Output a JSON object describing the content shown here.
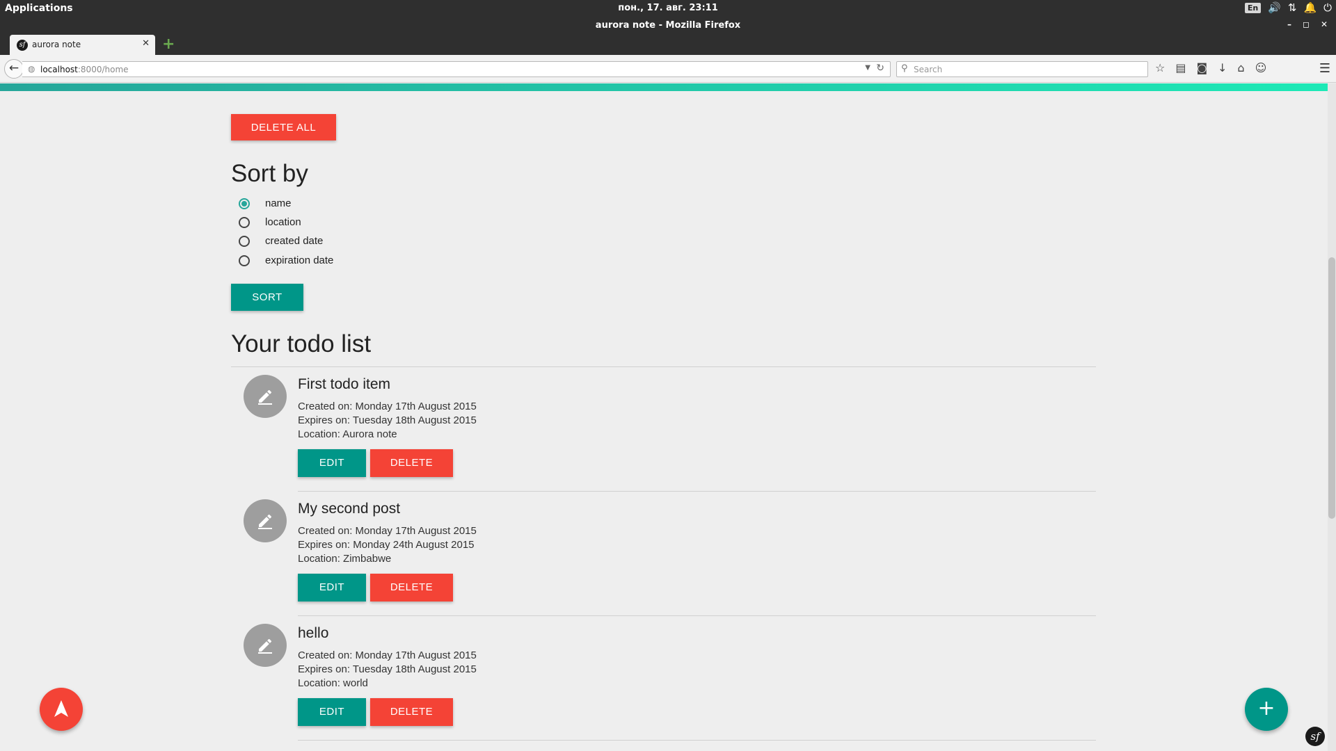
{
  "system": {
    "apps_label": "Applications",
    "clock": "пон., 17. авг.    23:11",
    "lang": "En",
    "tray_icons": [
      "volume-icon",
      "network-icon",
      "notification-icon",
      "power-icon"
    ]
  },
  "window": {
    "title": "aurora note - Mozilla Firefox",
    "controls": [
      "minimize-icon",
      "maximize-icon",
      "close-icon"
    ]
  },
  "browser": {
    "tab_title": "aurora note",
    "url_host": "localhost",
    "url_rest": ":8000/home",
    "search_placeholder": "Search"
  },
  "colors": {
    "accent_teal": "#009688",
    "danger_red": "#f44336",
    "radio_checked": "#26a69a"
  },
  "page": {
    "delete_all_label": "DELETE ALL",
    "sort_heading": "Sort by",
    "sort_options": [
      {
        "label": "name",
        "checked": true
      },
      {
        "label": "location",
        "checked": false
      },
      {
        "label": "created date",
        "checked": false
      },
      {
        "label": "expiration date",
        "checked": false
      }
    ],
    "sort_button_label": "SORT",
    "todo_heading": "Your todo list",
    "todos": [
      {
        "title": "First todo item",
        "created": "Created on: Monday 17th August 2015",
        "expires": "Expires on: Tuesday 18th August 2015",
        "location": "Location: Aurora note",
        "edit_label": "EDIT",
        "delete_label": "DELETE"
      },
      {
        "title": "My second post",
        "created": "Created on: Monday 17th August 2015",
        "expires": "Expires on: Monday 24th August 2015",
        "location": "Location: Zimbabwe",
        "edit_label": "EDIT",
        "delete_label": "DELETE"
      },
      {
        "title": "hello",
        "created": "Created on: Monday 17th August 2015",
        "expires": "Expires on: Tuesday 18th August 2015",
        "location": "Location: world",
        "edit_label": "EDIT",
        "delete_label": "DELETE"
      }
    ],
    "fab_add_label": "+"
  }
}
